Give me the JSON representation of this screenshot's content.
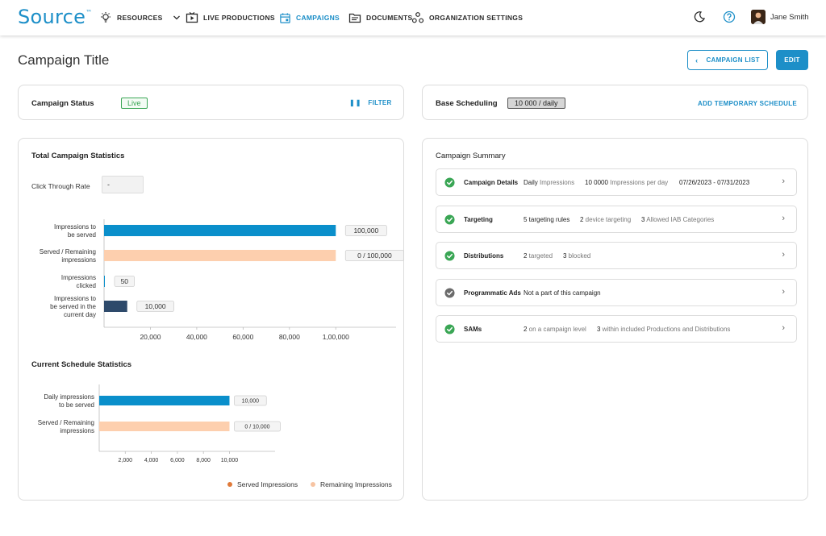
{
  "app": {
    "logo": "Source",
    "logo_mark": "™"
  },
  "nav": {
    "resources": "RESOURCES",
    "live_productions": "LIVE PRODUCTIONS",
    "campaigns": "CAMPAIGNS",
    "documents": "DOCUMENTS",
    "organization_settings": "ORGANIZATION SETTINGS"
  },
  "user": {
    "name": "Jane Smith"
  },
  "page": {
    "title": "Campaign Title",
    "campaign_list_label": "CAMPAIGN LIST",
    "edit_label": "EDIT"
  },
  "status_card": {
    "label": "Campaign Status",
    "status": "Live",
    "filter_label": "FILTER"
  },
  "scheduling_card": {
    "label": "Base Scheduling",
    "value": "10 000 / daily",
    "add_label": "ADD TEMPORARY SCHEDULE"
  },
  "stats": {
    "title": "Total Campaign Statistics",
    "ctr_label": "Click Through Rate",
    "ctr_value": "-",
    "schedule_title": "Current Schedule Statistics",
    "legend": {
      "served": "Served Impressions",
      "remaining": "Remaining Impressions"
    }
  },
  "colors": {
    "primary": "#1d8fc8",
    "bar_blue": "#0a8fcb",
    "bar_peach": "#fdcfae",
    "bar_navy": "#2e4a6b",
    "served": "#e07a3a",
    "remaining": "#f7c4a2",
    "success": "#3aa655",
    "neutral": "#6b6b6b"
  },
  "chart_data": [
    {
      "type": "bar",
      "orientation": "horizontal",
      "categories": [
        [
          "Impressions to",
          "be served"
        ],
        [
          "Served /  Remaining",
          "impressions"
        ],
        [
          "Impressions",
          "clicked"
        ],
        [
          "Impressions to",
          "be served in the",
          "current day"
        ]
      ],
      "values": [
        100000,
        100000,
        50,
        10000
      ],
      "data_labels": [
        "100,000",
        "0 / 100,000",
        "50",
        "10,000"
      ],
      "bar_colors": [
        "#0a8fcb",
        "#fdcfae",
        "#0a8fcb",
        "#2e4a6b"
      ],
      "xlim": [
        0,
        110000
      ],
      "xticks": [
        20000,
        40000,
        60000,
        80000,
        100000
      ],
      "xtick_labels": [
        "20,000",
        "40,000",
        "60,000",
        "80,000",
        "1,00,000"
      ]
    },
    {
      "type": "bar",
      "orientation": "horizontal",
      "categories": [
        [
          "Daily impressions",
          "to be served"
        ],
        [
          "Served / Remaining",
          "impressions"
        ]
      ],
      "values": [
        10000,
        10000
      ],
      "data_labels": [
        "10,000",
        "0 / 10,000"
      ],
      "bar_colors": [
        "#0a8fcb",
        "#fdcfae"
      ],
      "xlim": [
        0,
        13500
      ],
      "xticks": [
        2000,
        4000,
        6000,
        8000,
        10000
      ],
      "xtick_labels": [
        "2,000",
        "4,000",
        "6,000",
        "8,000",
        "10,000"
      ]
    }
  ],
  "summary": {
    "title": "Campaign Summary",
    "rows": [
      {
        "name": "Campaign Details",
        "status": "success",
        "parts": [
          {
            "strong": "Daily",
            "muted": "Impressions"
          },
          {
            "strong": "10 0000",
            "muted": "Impressions per day"
          },
          {
            "strong": "07/26/2023 - 07/31/2023",
            "muted": ""
          }
        ]
      },
      {
        "name": "Targeting",
        "status": "success",
        "parts": [
          {
            "strong": "5 targeting rules",
            "muted": ""
          },
          {
            "strong": "2",
            "muted": "device targeting"
          },
          {
            "strong": "3",
            "muted": "Allowed IAB Categories"
          }
        ]
      },
      {
        "name": "Distributions",
        "status": "success",
        "parts": [
          {
            "strong": "2",
            "muted": "targeted"
          },
          {
            "strong": "3",
            "muted": "blocked"
          }
        ]
      },
      {
        "name": "Programmatic Ads",
        "status": "neutral",
        "parts": [
          {
            "strong": "Not a part of this campaign",
            "muted": ""
          }
        ]
      },
      {
        "name": "SAMs",
        "status": "success",
        "parts": [
          {
            "strong": "2",
            "muted": "on a campaign level"
          },
          {
            "strong": "3",
            "muted": "within included Productions and Distributions"
          }
        ]
      }
    ]
  }
}
